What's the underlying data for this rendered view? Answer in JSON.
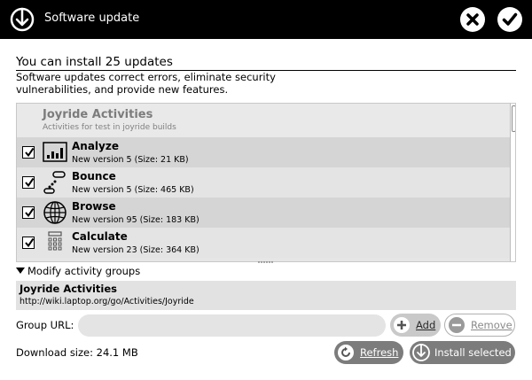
{
  "window": {
    "title": "Software update",
    "icons": {
      "app": "download-arrow-icon",
      "close": "close-icon",
      "confirm": "checkmark-icon"
    }
  },
  "header": {
    "heading": "You can install 25 updates",
    "description": "Software updates correct errors, eliminate security vulnerabilities, and provide new features."
  },
  "list": {
    "group": {
      "title": "Joyride Activities",
      "subtitle": "Activities for test in joyride builds"
    },
    "items": [
      {
        "name": "Analyze",
        "version": "New version 5 (Size: 21 KB)",
        "checked": true,
        "icon": "bar-chart-icon"
      },
      {
        "name": "Bounce",
        "version": "New version 5 (Size: 465 KB)",
        "checked": true,
        "icon": "bounce-icon"
      },
      {
        "name": "Browse",
        "version": "New version 95 (Size: 183 KB)",
        "checked": true,
        "icon": "globe-icon"
      },
      {
        "name": "Calculate",
        "version": "New version 23 (Size: 364 KB)",
        "checked": true,
        "icon": "calculator-icon"
      }
    ]
  },
  "groups": {
    "toggle_label": "Modify activity groups",
    "selected_title": "Joyride Activities",
    "selected_url": "http://wiki.laptop.org/go/Activities/Joyride"
  },
  "url_form": {
    "label": "Group URL:",
    "value": "",
    "add_label": "Add",
    "remove_label": "Remove"
  },
  "footer": {
    "download_size": "Download size: 24.1 MB",
    "refresh_label": "Refresh",
    "install_label": "Install selected"
  },
  "colors": {
    "titlebar": "#000000",
    "row_dark": "#d5d5d5",
    "row_light": "#e4e4e4",
    "button_dark": "#7c7c7c",
    "button_light": "#c9c9c9"
  }
}
